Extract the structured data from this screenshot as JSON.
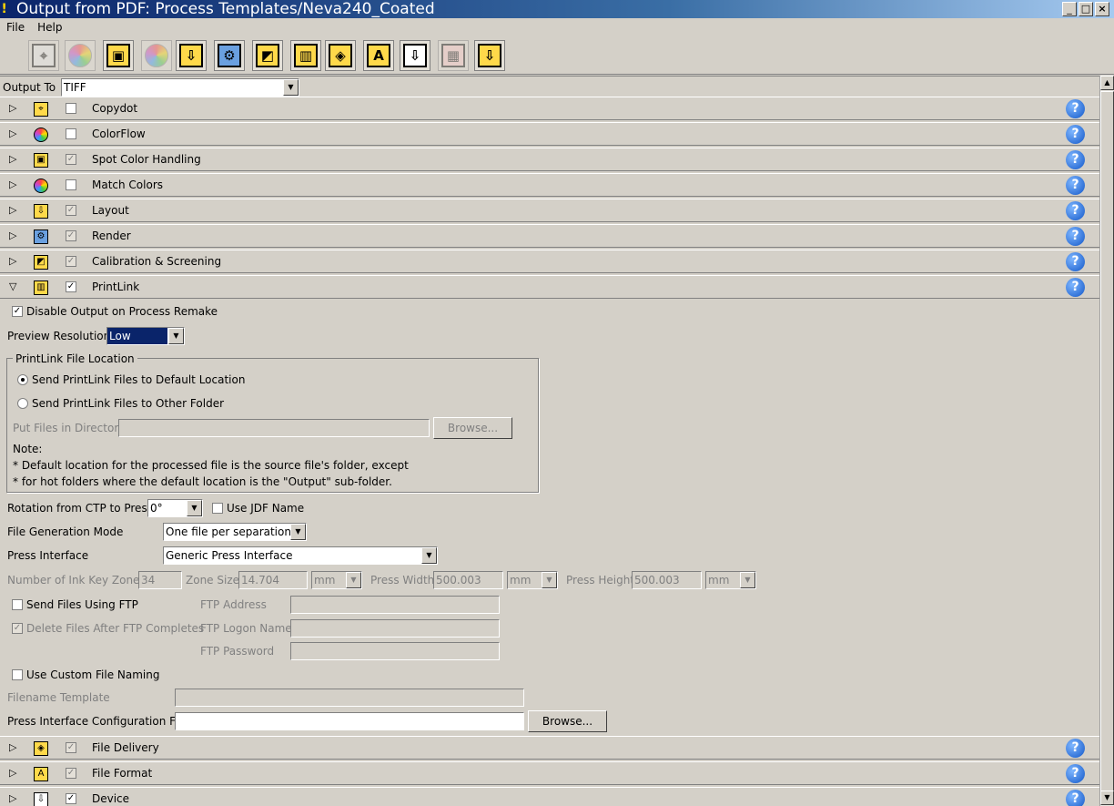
{
  "window": {
    "title": "Output from PDF: Process Templates/Neva240_Coated",
    "minimize": "_",
    "maximize": "□",
    "close": "×"
  },
  "menu": [
    "File",
    "Help"
  ],
  "toolbar": {
    "icons": [
      "copydot-icon",
      "colorflow-icon",
      "spot-color-icon",
      "match-colors-icon",
      "layout-icon",
      "render-icon",
      "calibration-icon",
      "printlink-icon",
      "file-delivery-icon",
      "file-format-icon",
      "device-icon",
      "disabled-icon",
      "extra-icon"
    ]
  },
  "output_to": {
    "label": "Output To",
    "value": "TIFF"
  },
  "sections": [
    {
      "label": "Copydot",
      "checked": false,
      "expanded": false
    },
    {
      "label": "ColorFlow",
      "checked": false,
      "expanded": false
    },
    {
      "label": "Spot Color Handling",
      "checked": true,
      "expanded": false
    },
    {
      "label": "Match Colors",
      "checked": false,
      "expanded": false
    },
    {
      "label": "Layout",
      "checked": true,
      "expanded": false
    },
    {
      "label": "Render",
      "checked": true,
      "expanded": false
    },
    {
      "label": "Calibration & Screening",
      "checked": true,
      "expanded": false
    },
    {
      "label": "PrintLink",
      "checked": true,
      "expanded": true
    },
    {
      "label": "File Delivery",
      "checked": true,
      "expanded": false
    },
    {
      "label": "File Format",
      "checked": true,
      "expanded": false
    },
    {
      "label": "Device",
      "checked": true,
      "expanded": false
    }
  ],
  "help": "?",
  "printlink": {
    "disable_output": "Disable Output on Process Remake",
    "preview_resolution_label": "Preview Resolution",
    "preview_resolution_value": "Low",
    "file_location_title": "PrintLink File Location",
    "send_default": "Send PrintLink Files to Default Location",
    "send_other": "Send PrintLink Files to Other Folder",
    "put_files_label": "Put Files in Directory",
    "put_files_value": "",
    "browse": "Browse...",
    "note_title": "Note:",
    "note_line1": "*  Default location for the processed file is the source file's folder, except",
    "note_line2": "*  for hot folders where the default location is the \"Output\" sub-folder.",
    "rotation_label": "Rotation from CTP to Press",
    "rotation_value": "0°",
    "use_jdf_name": "Use JDF Name",
    "file_gen_label": "File Generation Mode",
    "file_gen_value": "One file per separation",
    "press_interface_label": "Press Interface",
    "press_interface_value": "Generic Press Interface",
    "ink_zones_label": "Number of Ink Key Zones",
    "ink_zones_value": "34",
    "zone_size_label": "Zone Size",
    "zone_size_value": "14.704",
    "zone_size_unit": "mm",
    "press_width_label": "Press Width",
    "press_width_value": "500.003",
    "press_width_unit": "mm",
    "press_height_label": "Press Height",
    "press_height_value": "500.003",
    "press_height_unit": "mm",
    "send_ftp": "Send Files Using FTP",
    "delete_after_ftp": "Delete Files After FTP Completes",
    "ftp_address_label": "FTP Address",
    "ftp_logon_label": "FTP Logon Name",
    "ftp_password_label": "FTP Password",
    "custom_naming": "Use Custom File Naming",
    "filename_template_label": "Filename Template",
    "config_file_label": "Press Interface Configuration File",
    "config_file_value": "",
    "config_browse": "Browse..."
  }
}
